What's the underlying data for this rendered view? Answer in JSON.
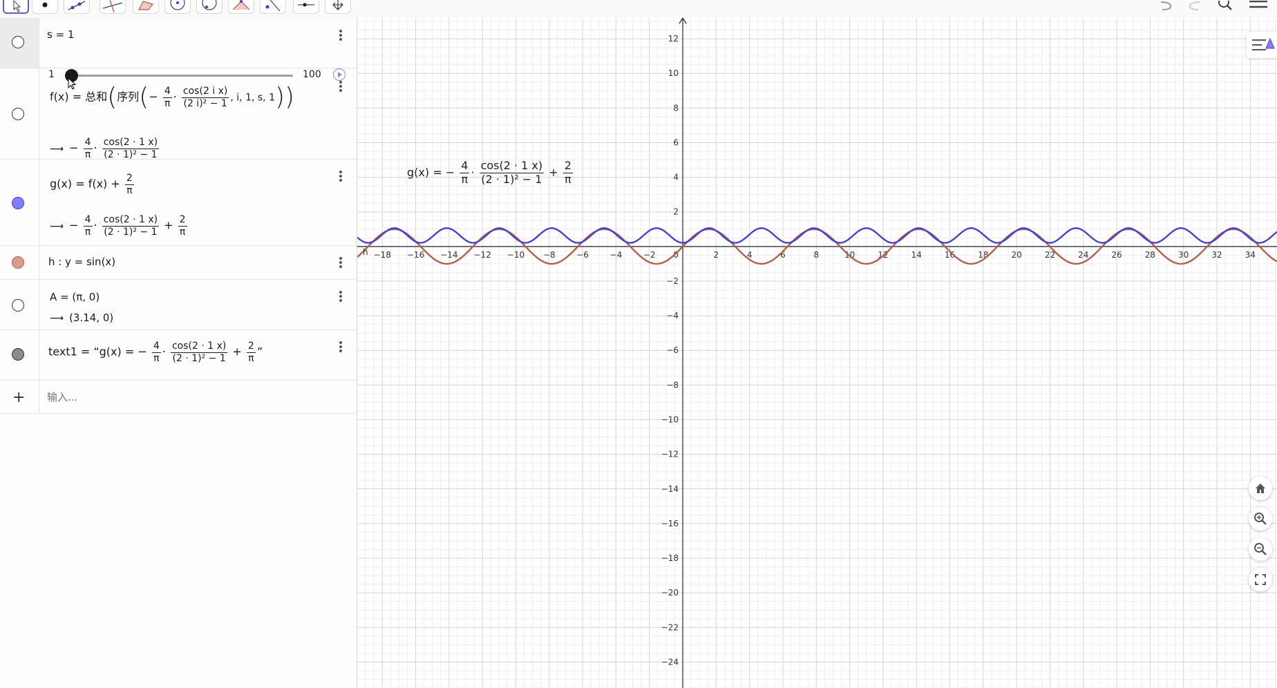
{
  "toolbar": {
    "tools": [
      "move-tool",
      "point-tool",
      "line-tool",
      "perpendicular-line-tool",
      "polygon-tool",
      "circle-tool",
      "circle-through-points-tool",
      "angle-tool",
      "reflect-tool",
      "slider-tool",
      "move-graphics-view-tool"
    ],
    "right": [
      "undo-icon",
      "redo-icon",
      "search-icon",
      "menu-icon"
    ]
  },
  "algebra": {
    "slider": {
      "definition": "s = 1",
      "min": "1",
      "max": "100",
      "value_fraction": 0.0
    },
    "f": {
      "lhs": "f(x)",
      "eq": "=",
      "sum": "总和",
      "seq": "序列",
      "neg": "−",
      "num4": "4",
      "pi": "π",
      "dot": "·",
      "cos_num": "cos(2 i x)",
      "cos_den": "(2 i)² − 1",
      "args": ", i, 1, s, 1",
      "out_cos_num": "cos(2 · 1 x)",
      "out_cos_den": "(2 · 1)² − 1"
    },
    "g": {
      "lhs": "g(x)",
      "eq": "=",
      "rhs": "f(x) +",
      "two": "2",
      "pi": "π",
      "out_plus": "+"
    },
    "h": {
      "definition": "h : y = sin(x)"
    },
    "A": {
      "definition": "A = (π, 0)",
      "value": "(3.14, 0)"
    },
    "text1": {
      "lhs": "text1 = “g(x) =",
      "close_quote": "”"
    },
    "input": {
      "placeholder": "输入..."
    },
    "arrow": "⟶",
    "colors": {
      "g_marble": "#8080ff",
      "h_marble": "#d8a08c",
      "text_marble": "#8c8c8c"
    }
  },
  "graphics": {
    "text_label": {
      "lhs": "g(x) =",
      "neg": "−",
      "num4": "4",
      "pi": "π",
      "cos_num": "cos(2 · 1 x)",
      "cos_den": "(2 · 1)² − 1",
      "plus": "+",
      "two": "2"
    },
    "point_label": "h",
    "x_range": [
      -19.5,
      35.6
    ],
    "y_range": [
      -25.5,
      13.2
    ],
    "x_ticks": [
      "-18",
      "-16",
      "-14",
      "-12",
      "-10",
      "-8",
      "-6",
      "-4",
      "-2",
      "0",
      "2",
      "4",
      "6",
      "8",
      "10",
      "12",
      "14",
      "16",
      "18",
      "20",
      "22",
      "24",
      "26",
      "28",
      "30",
      "32",
      "34"
    ],
    "y_ticks": [
      "12",
      "10",
      "8",
      "6",
      "4",
      "2",
      "-2",
      "-4",
      "-6",
      "-8",
      "-10",
      "-12",
      "-14",
      "-16",
      "-18",
      "-20",
      "-22",
      "-24"
    ],
    "curves": {
      "g_color": "#4a3fcf",
      "h_color": "#b05f4a"
    },
    "buttons": [
      "home-icon",
      "zoom-in-icon",
      "zoom-out-icon",
      "fullscreen-icon"
    ]
  }
}
